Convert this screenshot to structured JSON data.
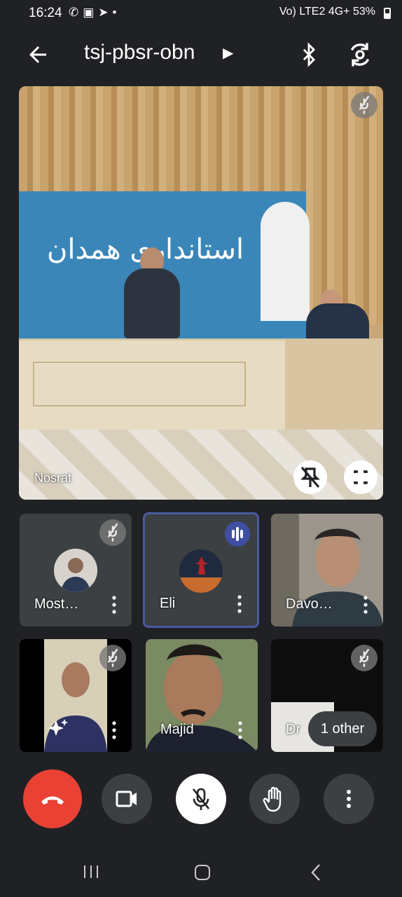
{
  "status_bar": {
    "time": "16:24",
    "left_icons": "✆▣➤•",
    "network": "Vo) LTE2 4G+",
    "battery": "53%"
  },
  "header": {
    "title": "tsj-pbsr-obn"
  },
  "main_tile": {
    "name": "Nosrat",
    "banner_text": "استانداری همدان"
  },
  "participants": [
    {
      "name": "Most…"
    },
    {
      "name": "Eli"
    },
    {
      "name": "Davo…"
    },
    {
      "name": ""
    },
    {
      "name": "Majid"
    },
    {
      "name": "Dr"
    }
  ],
  "others_chip": "1 other",
  "colors": {
    "background": "#202124",
    "end_call": "#e94235",
    "speaking_border": "#4b5a9e",
    "tile": "#3c4043"
  }
}
